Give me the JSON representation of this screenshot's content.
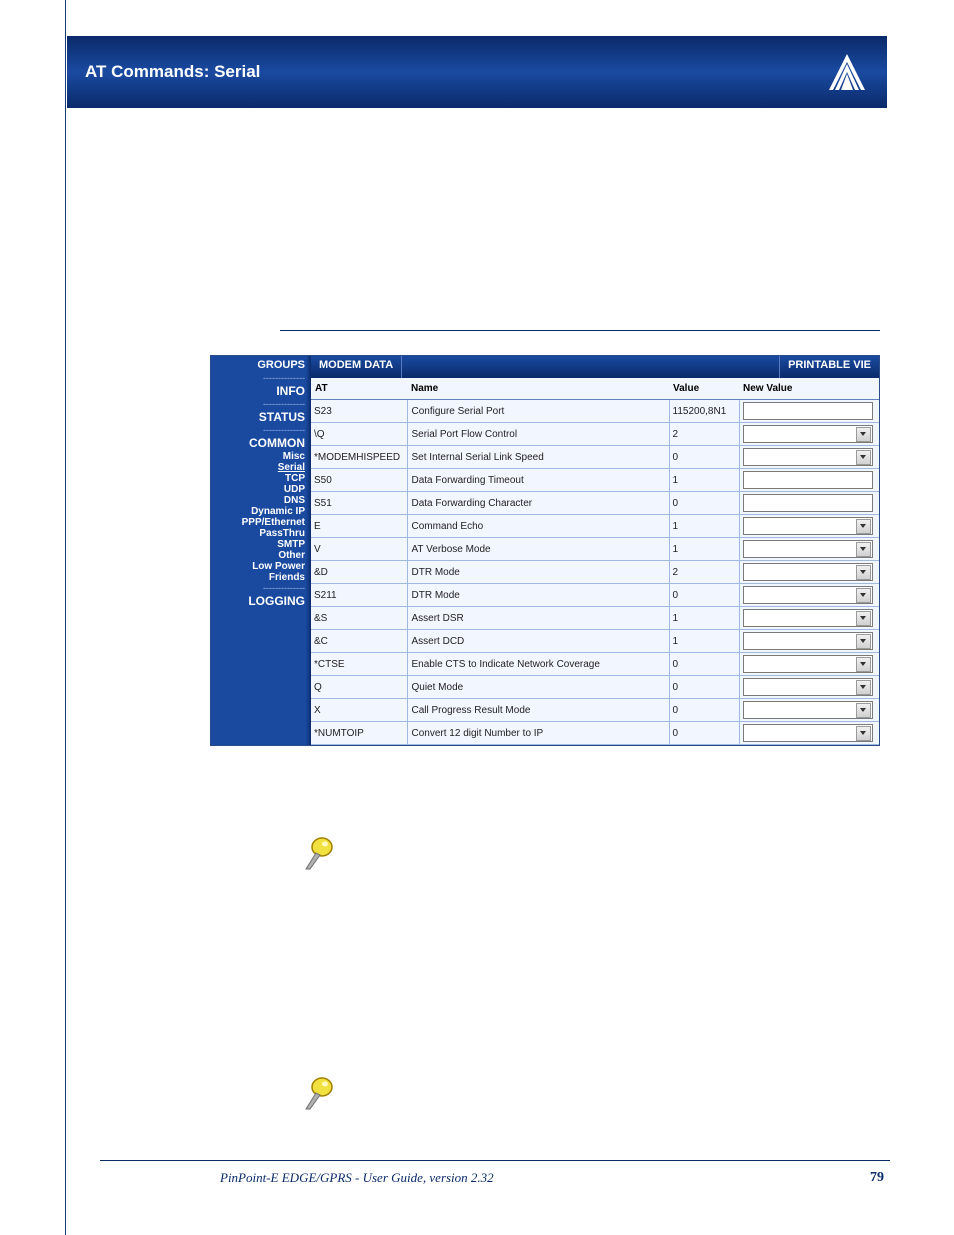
{
  "header": {
    "title": "AT Commands: Serial"
  },
  "sidebar": {
    "groups_label": "GROUPS",
    "info": "INFO",
    "status": "STATUS",
    "common": "COMMON",
    "common_items": [
      "Misc",
      "Serial",
      "TCP",
      "UDP",
      "DNS",
      "Dynamic IP",
      "PPP/Ethernet",
      "PassThru",
      "SMTP",
      "Other",
      "Low Power",
      "Friends"
    ],
    "active_common_item": "Serial",
    "logging": "LOGGING"
  },
  "tabs": {
    "modem_data": "MODEM DATA",
    "printable": "PRINTABLE VIE"
  },
  "table": {
    "headers": {
      "at": "AT",
      "name": "Name",
      "value": "Value",
      "new_value": "New Value"
    },
    "rows": [
      {
        "at": "S23",
        "name": "Configure Serial Port",
        "value": "115200,8N1",
        "control": "text"
      },
      {
        "at": "\\Q",
        "name": "Serial Port Flow Control",
        "value": "2",
        "control": "select"
      },
      {
        "at": "*MODEMHISPEED",
        "name": "Set Internal Serial Link Speed",
        "value": "0",
        "control": "select"
      },
      {
        "at": "S50",
        "name": "Data Forwarding Timeout",
        "value": "1",
        "control": "text"
      },
      {
        "at": "S51",
        "name": "Data Forwarding Character",
        "value": "0",
        "control": "text"
      },
      {
        "at": "E",
        "name": "Command Echo",
        "value": "1",
        "control": "select"
      },
      {
        "at": "V",
        "name": "AT Verbose Mode",
        "value": "1",
        "control": "select"
      },
      {
        "at": "&D",
        "name": "DTR Mode",
        "value": "2",
        "control": "select"
      },
      {
        "at": "S211",
        "name": "DTR Mode",
        "value": "0",
        "control": "select"
      },
      {
        "at": "&S",
        "name": "Assert DSR",
        "value": "1",
        "control": "select"
      },
      {
        "at": "&C",
        "name": "Assert DCD",
        "value": "1",
        "control": "select"
      },
      {
        "at": "*CTSE",
        "name": "Enable CTS to Indicate Network Coverage",
        "value": "0",
        "control": "select"
      },
      {
        "at": "Q",
        "name": "Quiet Mode",
        "value": "0",
        "control": "select"
      },
      {
        "at": "X",
        "name": "Call Progress Result Mode",
        "value": "0",
        "control": "select"
      },
      {
        "at": "*NUMTOIP",
        "name": "Convert 12 digit Number to IP",
        "value": "0",
        "control": "select"
      }
    ]
  },
  "footer": {
    "text": "PinPoint-E EDGE/GPRS - User Guide, version 2.32",
    "page": "79"
  }
}
